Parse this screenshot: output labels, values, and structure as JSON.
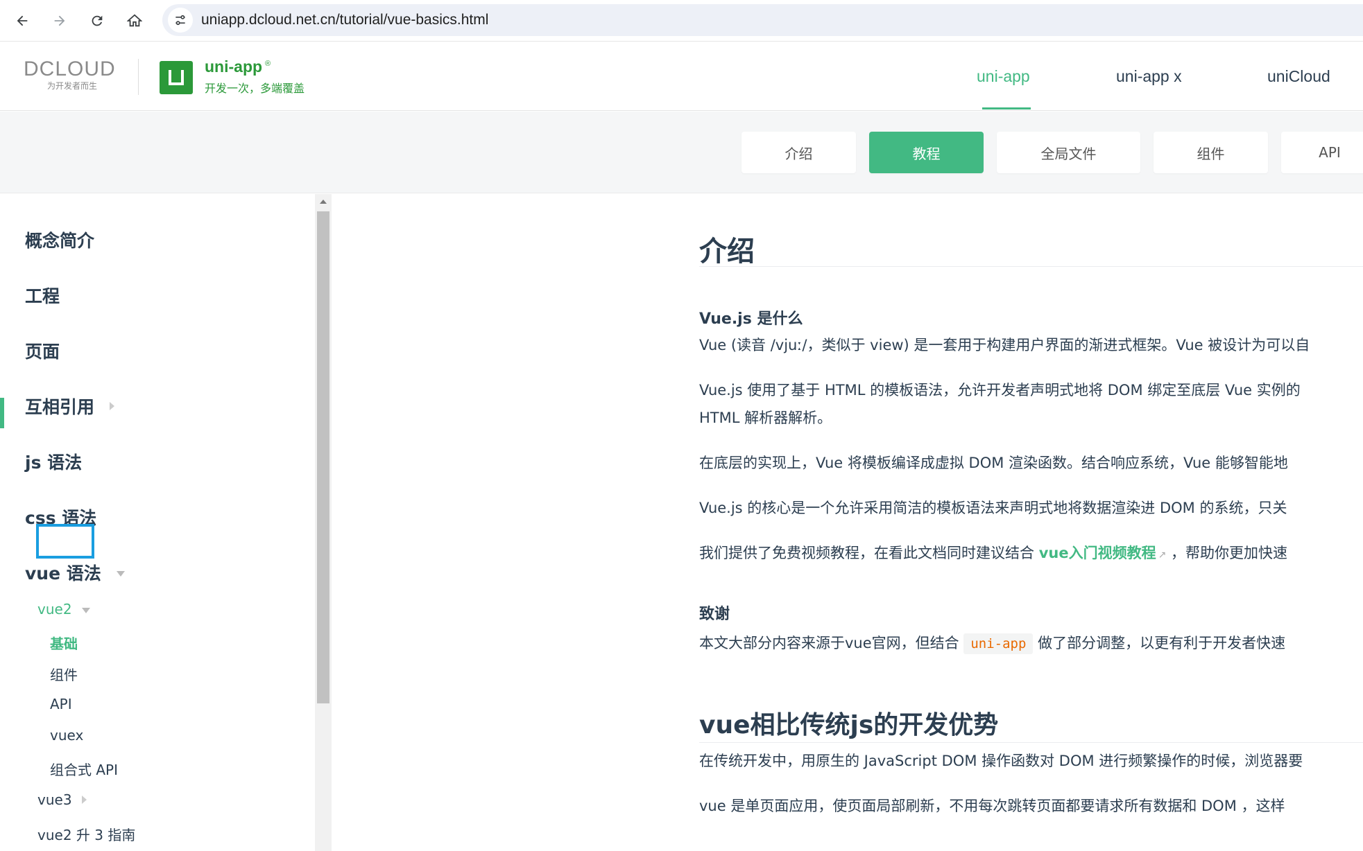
{
  "browser": {
    "url": "uniapp.dcloud.net.cn/tutorial/vue-basics.html"
  },
  "header": {
    "dcloud_word": "DCLOUD",
    "dcloud_tagline": "为开发者而生",
    "logo_letter": "U",
    "app_name": "uni-app",
    "app_trademark": "®",
    "slogan": "开发一次，多端覆盖",
    "tabs": [
      {
        "label": "uni-app",
        "active": true
      },
      {
        "label": "uni-app x",
        "active": false
      },
      {
        "label": "uniCloud",
        "active": false
      }
    ]
  },
  "subnav": [
    {
      "label": "介绍",
      "active": false
    },
    {
      "label": "教程",
      "active": true
    },
    {
      "label": "全局文件",
      "active": false
    },
    {
      "label": "组件",
      "active": false
    },
    {
      "label": "API",
      "active": false
    }
  ],
  "sidebar": {
    "items": [
      {
        "label": "概念简介"
      },
      {
        "label": "工程"
      },
      {
        "label": "页面"
      },
      {
        "label": "互相引用"
      },
      {
        "label": "js 语法"
      },
      {
        "label": "css 语法"
      },
      {
        "label": "vue 语法"
      }
    ],
    "vue2": "vue2",
    "vue2_children": [
      "基础",
      "组件",
      "API",
      "vuex",
      "组合式 API"
    ],
    "vue3": "vue3",
    "vue2to3": "vue2 升 3 指南"
  },
  "content": {
    "title": "介绍",
    "what_heading": "Vue.js 是什么",
    "p1": "Vue (读音 /vjuː/，类似于 view) 是一套用于构建用户界面的渐进式框架。Vue 被设计为可以自",
    "p2_line1": "Vue.js 使用了基于 HTML 的模板语法，允许开发者声明式地将 DOM 绑定至底层 Vue 实例的",
    "p2_line2": "HTML 解析器解析。",
    "p3": "在底层的实现上，Vue 将模板编译成虚拟 DOM 渲染函数。结合响应系统，Vue 能够智能地",
    "p4": "Vue.js 的核心是一个允许采用简洁的模板语法来声明式地将数据渲染进 DOM 的系统，只关",
    "p5_before": "我们提供了免费视频教程，在看此文档同时建议结合 ",
    "p5_link": "vue入门视频教程",
    "p5_after": " ，帮助你更加快速",
    "thanks_heading": "致谢",
    "p6_before": "本文大部分内容来源于vue官网，但结合 ",
    "p6_code": "uni-app",
    "p6_after": " 做了部分调整，以更有利于开发者快速",
    "h2": "vue相比传统js的开发优势",
    "p7": "在传统开发中，用原生的 JavaScript DOM 操作函数对 DOM 进行频繁操作的时候，浏览器要",
    "p8": "vue 是单页面应用，使页面局部刷新，不用每次跳转页面都要请求所有数据和 DOM ，这样"
  }
}
